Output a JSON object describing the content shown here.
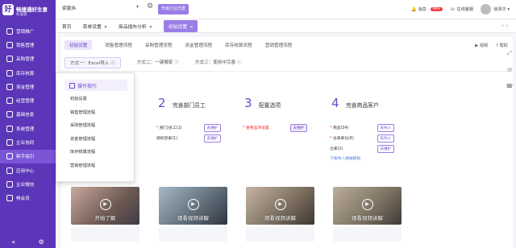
{
  "app": {
    "name": "畅捷通好生意",
    "sub": "标准版",
    "logo_char": "好"
  },
  "sidebar": {
    "items": [
      {
        "label": "营销推广",
        "icon": "megaphone-icon"
      },
      {
        "label": "销售管理",
        "icon": "cart-icon"
      },
      {
        "label": "采购管理",
        "icon": "bag-icon"
      },
      {
        "label": "库存核算",
        "icon": "box-icon"
      },
      {
        "label": "资金管理",
        "icon": "wallet-icon"
      },
      {
        "label": "经营管理",
        "icon": "chart-icon"
      },
      {
        "label": "基础信息",
        "icon": "info-icon"
      },
      {
        "label": "系统管理",
        "icon": "gear-icon"
      },
      {
        "label": "企业协同",
        "icon": "link-icon"
      },
      {
        "label": "新手指引",
        "icon": "guide-icon"
      },
      {
        "label": "应用中心",
        "icon": "apps-icon"
      },
      {
        "label": "企业微信",
        "icon": "wechat-icon"
      },
      {
        "label": "畅会员",
        "icon": "member-icon"
      }
    ],
    "active": 9,
    "bottom_icons": [
      "fold-icon",
      "settings-icon"
    ]
  },
  "topbar": {
    "company": "梁嘉伟",
    "plan_button": "升级行业方案",
    "messages": "消息",
    "message_count": "99+",
    "support": "在线客服",
    "user": "徐泽华"
  },
  "tabs": [
    {
      "label": "首页",
      "closable": false
    },
    {
      "label": "菜单设置",
      "closable": true
    },
    {
      "label": "商品插布分析",
      "closable": true
    },
    {
      "label": "初始设置",
      "closable": true,
      "active": true
    }
  ],
  "subtabs": [
    "初始设置",
    "销售管理流程",
    "采购管理流程",
    "资金管理流程",
    "库存核算流程",
    "营销管理流程"
  ],
  "right_links": {
    "video": "视频",
    "help": "帮助"
  },
  "methods": [
    "方式一：Excel导入",
    "方式二：一键搬家",
    "方式三：使用中完善"
  ],
  "dropdown": {
    "title": "操作指引",
    "items": [
      "初始设置",
      "销售管理流程",
      "采购管理流程",
      "资金管理流程",
      "库存核算流程",
      "营销管理流程"
    ]
  },
  "cards": [
    {
      "num": "2",
      "title": "完善部门员工",
      "items": [
        {
          "label": "部门/员工(1)",
          "required": true,
          "btn": "去维护"
        },
        {
          "label": "授权登录(1)",
          "required": false,
          "btn": "去维护"
        }
      ]
    },
    {
      "num": "3",
      "title": "配置选项",
      "items": [
        {
          "label": "重要选项设置",
          "required": true,
          "btn": "去维护",
          "red": true
        }
      ]
    },
    {
      "num": "4",
      "title": "完善商品客户",
      "items": [
        {
          "label": "商品(34)",
          "required": true,
          "btn": "去导入"
        },
        {
          "label": "往来单位(6)",
          "required": true,
          "btn": "去导入"
        },
        {
          "label": "仓库(2)",
          "required": false,
          "btn": "去维护"
        }
      ],
      "link": "下载导入数据模板"
    }
  ],
  "videos": [
    "开始了解",
    "观看视频讲解",
    "观看视频讲解",
    "观看视频讲解"
  ]
}
